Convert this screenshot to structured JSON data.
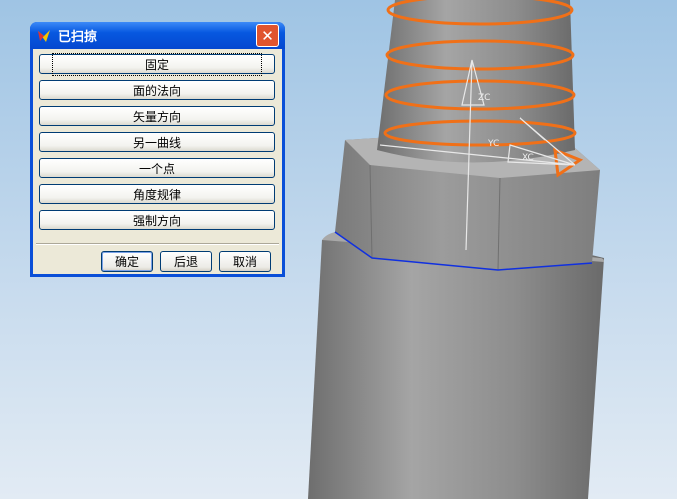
{
  "dialog": {
    "title": "已扫掠",
    "close_icon": "close-icon",
    "options": [
      "固定",
      "面的法向",
      "矢量方向",
      "另一曲线",
      "一个点",
      "角度规律",
      "强制方向"
    ],
    "focused_option": "固定",
    "buttons": {
      "ok": "确定",
      "back": "后退",
      "cancel": "取消"
    }
  },
  "viewport": {
    "axis_labels": {
      "z": "ZC",
      "y": "YC",
      "x": "XC"
    },
    "colors": {
      "helix": "#f07018",
      "section_curve": "#1030e0",
      "model": "#8a8a8a"
    }
  }
}
